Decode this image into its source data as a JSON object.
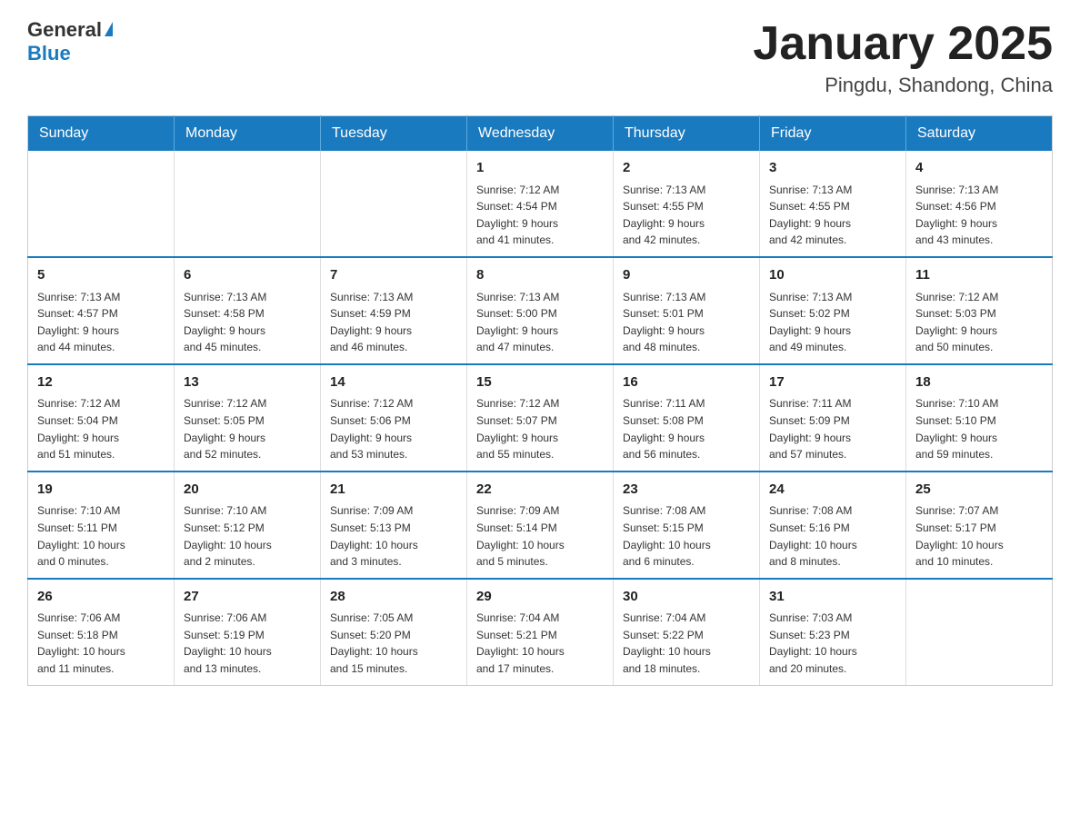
{
  "header": {
    "logo_general": "General",
    "logo_blue": "Blue",
    "month_title": "January 2025",
    "location": "Pingdu, Shandong, China"
  },
  "calendar": {
    "days_of_week": [
      "Sunday",
      "Monday",
      "Tuesday",
      "Wednesday",
      "Thursday",
      "Friday",
      "Saturday"
    ],
    "weeks": [
      [
        {
          "day": "",
          "info": ""
        },
        {
          "day": "",
          "info": ""
        },
        {
          "day": "",
          "info": ""
        },
        {
          "day": "1",
          "info": "Sunrise: 7:12 AM\nSunset: 4:54 PM\nDaylight: 9 hours\nand 41 minutes."
        },
        {
          "day": "2",
          "info": "Sunrise: 7:13 AM\nSunset: 4:55 PM\nDaylight: 9 hours\nand 42 minutes."
        },
        {
          "day": "3",
          "info": "Sunrise: 7:13 AM\nSunset: 4:55 PM\nDaylight: 9 hours\nand 42 minutes."
        },
        {
          "day": "4",
          "info": "Sunrise: 7:13 AM\nSunset: 4:56 PM\nDaylight: 9 hours\nand 43 minutes."
        }
      ],
      [
        {
          "day": "5",
          "info": "Sunrise: 7:13 AM\nSunset: 4:57 PM\nDaylight: 9 hours\nand 44 minutes."
        },
        {
          "day": "6",
          "info": "Sunrise: 7:13 AM\nSunset: 4:58 PM\nDaylight: 9 hours\nand 45 minutes."
        },
        {
          "day": "7",
          "info": "Sunrise: 7:13 AM\nSunset: 4:59 PM\nDaylight: 9 hours\nand 46 minutes."
        },
        {
          "day": "8",
          "info": "Sunrise: 7:13 AM\nSunset: 5:00 PM\nDaylight: 9 hours\nand 47 minutes."
        },
        {
          "day": "9",
          "info": "Sunrise: 7:13 AM\nSunset: 5:01 PM\nDaylight: 9 hours\nand 48 minutes."
        },
        {
          "day": "10",
          "info": "Sunrise: 7:13 AM\nSunset: 5:02 PM\nDaylight: 9 hours\nand 49 minutes."
        },
        {
          "day": "11",
          "info": "Sunrise: 7:12 AM\nSunset: 5:03 PM\nDaylight: 9 hours\nand 50 minutes."
        }
      ],
      [
        {
          "day": "12",
          "info": "Sunrise: 7:12 AM\nSunset: 5:04 PM\nDaylight: 9 hours\nand 51 minutes."
        },
        {
          "day": "13",
          "info": "Sunrise: 7:12 AM\nSunset: 5:05 PM\nDaylight: 9 hours\nand 52 minutes."
        },
        {
          "day": "14",
          "info": "Sunrise: 7:12 AM\nSunset: 5:06 PM\nDaylight: 9 hours\nand 53 minutes."
        },
        {
          "day": "15",
          "info": "Sunrise: 7:12 AM\nSunset: 5:07 PM\nDaylight: 9 hours\nand 55 minutes."
        },
        {
          "day": "16",
          "info": "Sunrise: 7:11 AM\nSunset: 5:08 PM\nDaylight: 9 hours\nand 56 minutes."
        },
        {
          "day": "17",
          "info": "Sunrise: 7:11 AM\nSunset: 5:09 PM\nDaylight: 9 hours\nand 57 minutes."
        },
        {
          "day": "18",
          "info": "Sunrise: 7:10 AM\nSunset: 5:10 PM\nDaylight: 9 hours\nand 59 minutes."
        }
      ],
      [
        {
          "day": "19",
          "info": "Sunrise: 7:10 AM\nSunset: 5:11 PM\nDaylight: 10 hours\nand 0 minutes."
        },
        {
          "day": "20",
          "info": "Sunrise: 7:10 AM\nSunset: 5:12 PM\nDaylight: 10 hours\nand 2 minutes."
        },
        {
          "day": "21",
          "info": "Sunrise: 7:09 AM\nSunset: 5:13 PM\nDaylight: 10 hours\nand 3 minutes."
        },
        {
          "day": "22",
          "info": "Sunrise: 7:09 AM\nSunset: 5:14 PM\nDaylight: 10 hours\nand 5 minutes."
        },
        {
          "day": "23",
          "info": "Sunrise: 7:08 AM\nSunset: 5:15 PM\nDaylight: 10 hours\nand 6 minutes."
        },
        {
          "day": "24",
          "info": "Sunrise: 7:08 AM\nSunset: 5:16 PM\nDaylight: 10 hours\nand 8 minutes."
        },
        {
          "day": "25",
          "info": "Sunrise: 7:07 AM\nSunset: 5:17 PM\nDaylight: 10 hours\nand 10 minutes."
        }
      ],
      [
        {
          "day": "26",
          "info": "Sunrise: 7:06 AM\nSunset: 5:18 PM\nDaylight: 10 hours\nand 11 minutes."
        },
        {
          "day": "27",
          "info": "Sunrise: 7:06 AM\nSunset: 5:19 PM\nDaylight: 10 hours\nand 13 minutes."
        },
        {
          "day": "28",
          "info": "Sunrise: 7:05 AM\nSunset: 5:20 PM\nDaylight: 10 hours\nand 15 minutes."
        },
        {
          "day": "29",
          "info": "Sunrise: 7:04 AM\nSunset: 5:21 PM\nDaylight: 10 hours\nand 17 minutes."
        },
        {
          "day": "30",
          "info": "Sunrise: 7:04 AM\nSunset: 5:22 PM\nDaylight: 10 hours\nand 18 minutes."
        },
        {
          "day": "31",
          "info": "Sunrise: 7:03 AM\nSunset: 5:23 PM\nDaylight: 10 hours\nand 20 minutes."
        },
        {
          "day": "",
          "info": ""
        }
      ]
    ]
  }
}
